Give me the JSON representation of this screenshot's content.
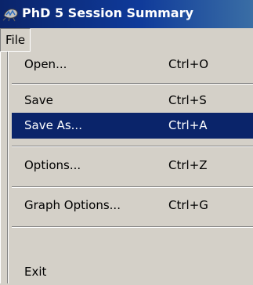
{
  "window": {
    "title": "PhD 5 Session Summary",
    "icon": "app-icon"
  },
  "menubar": {
    "file_label": "File"
  },
  "file_menu": {
    "items": [
      {
        "label": "Open...",
        "shortcut": "Ctrl+O",
        "highlighted": false
      },
      {
        "label": "Save",
        "shortcut": "Ctrl+S",
        "highlighted": false
      },
      {
        "label": "Save As...",
        "shortcut": "Ctrl+A",
        "highlighted": true
      },
      {
        "label": "Options...",
        "shortcut": "Ctrl+Z",
        "highlighted": false
      },
      {
        "label": "Graph Options...",
        "shortcut": "Ctrl+G",
        "highlighted": false
      },
      {
        "label": "Exit",
        "shortcut": "",
        "highlighted": false
      }
    ]
  },
  "colors": {
    "title_bar": "#0a246a",
    "highlight": "#0a246a",
    "menu_bg": "#d4d0c8"
  }
}
